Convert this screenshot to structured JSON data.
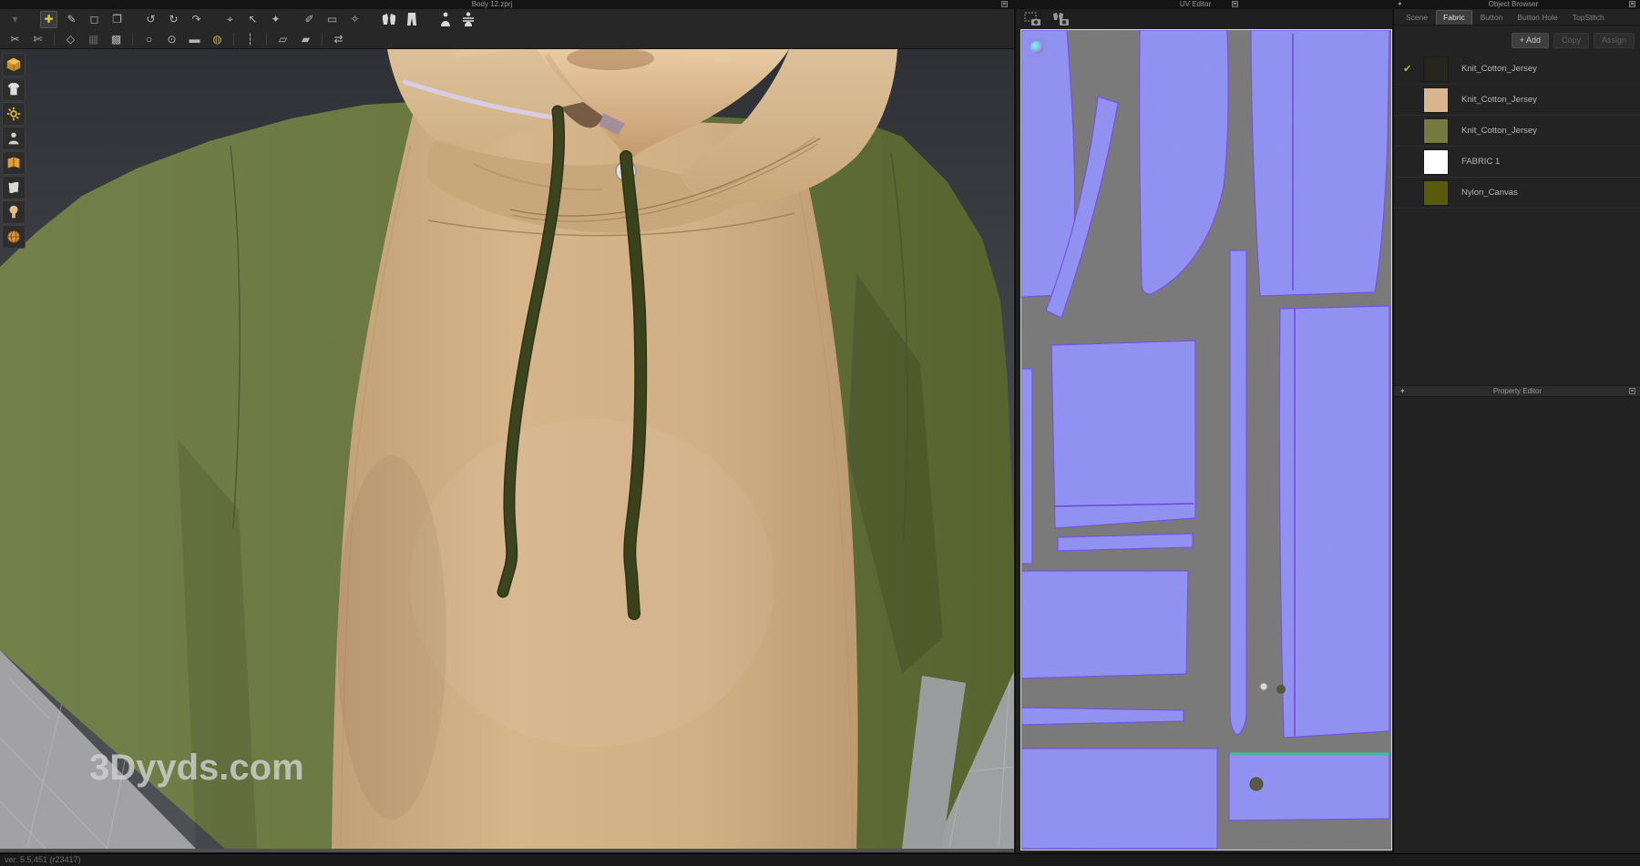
{
  "window": {
    "viewport_title": "Body 12.zprj",
    "uv_editor_title": "UV Editor",
    "object_browser_title": "Object Browser",
    "property_editor_title": "Property Editor"
  },
  "watermark": "3Dyyds.com",
  "status_bar": {
    "version_text": "ver. 5.5.451 (r23417)"
  },
  "toolbar": {
    "row1": [
      {
        "name": "import-dropdown-icon",
        "glyph": "▾",
        "variant": "dim"
      },
      {
        "name": "move-tool-icon",
        "glyph": "✚",
        "variant": "sel"
      },
      {
        "name": "edit-pattern-tool-icon",
        "glyph": "✎",
        "variant": ""
      },
      {
        "name": "transform-pattern-tool-icon",
        "glyph": "◻",
        "variant": ""
      },
      {
        "name": "paste-pattern-tool-icon",
        "glyph": "❐",
        "variant": ""
      },
      {
        "name": "fold-left-tool-icon",
        "glyph": "↺",
        "variant": ""
      },
      {
        "name": "fold-right-tool-icon",
        "glyph": "↻",
        "variant": ""
      },
      {
        "name": "fold-arrangement-tool-icon",
        "glyph": "↷",
        "variant": ""
      },
      {
        "name": "pin-tool-icon",
        "glyph": "⌖",
        "variant": ""
      },
      {
        "name": "drag-garment-tool-icon",
        "glyph": "↖",
        "variant": ""
      },
      {
        "name": "reset-garment-tool-icon",
        "glyph": "✦",
        "variant": ""
      },
      {
        "name": "sewing-edit-tool-icon",
        "glyph": "✐",
        "variant": ""
      },
      {
        "name": "steam-roller-tool-icon",
        "glyph": "▭",
        "variant": ""
      },
      {
        "name": "refresh-drape-tool-icon",
        "glyph": "✧",
        "variant": ""
      }
    ],
    "row2": [
      {
        "name": "trace-cursor-tool-icon",
        "glyph": "✂",
        "variant": ""
      },
      {
        "name": "cut-and-sew-tool-icon",
        "glyph": "✄",
        "variant": ""
      },
      {
        "name": "polygon-pattern-tool-icon",
        "glyph": "◇",
        "variant": ""
      },
      {
        "name": "mesh-select-tool-icon",
        "glyph": "▦",
        "variant": "dim"
      },
      {
        "name": "mesh-edit-tool-icon",
        "glyph": "▩",
        "variant": ""
      },
      {
        "name": "button-cursor-tool-icon",
        "glyph": "○",
        "variant": ""
      },
      {
        "name": "button-tool-icon",
        "glyph": "⊙",
        "variant": ""
      },
      {
        "name": "seam-line-tool-icon",
        "glyph": "▬",
        "variant": ""
      },
      {
        "name": "grading-lock-tool-icon",
        "glyph": "◍",
        "variant": "accent"
      },
      {
        "name": "zipper-tool-icon",
        "glyph": "┆",
        "variant": ""
      },
      {
        "name": "flattening-cursor-tool-icon",
        "glyph": "▱",
        "variant": ""
      },
      {
        "name": "flattening-tool-icon",
        "glyph": "▰",
        "variant": ""
      },
      {
        "name": "symmetry-tool-icon",
        "glyph": "⇄",
        "variant": ""
      }
    ]
  },
  "object_browser": {
    "tabs": [
      "Scene",
      "Fabric",
      "Button",
      "Button Hole",
      "TopStitch"
    ],
    "active_tab": "Fabric",
    "buttons": {
      "add": "+ Add",
      "copy": "Copy",
      "assign": "Assign"
    },
    "fabrics": [
      {
        "name": "Knit_Cotton_Jersey",
        "swatch": "#26261e",
        "selected": true
      },
      {
        "name": "Knit_Cotton_Jersey",
        "swatch": "#d9b48e",
        "selected": false
      },
      {
        "name": "Knit_Cotton_Jersey",
        "swatch": "#75793f",
        "selected": false
      },
      {
        "name": "FABRIC 1",
        "swatch": "#ffffff",
        "selected": false
      },
      {
        "name": "Nylon_Canvas",
        "swatch": "#5a5910",
        "selected": false
      }
    ]
  },
  "icons": {
    "check": "✔",
    "panel_arrow": "✦"
  },
  "colors": {
    "uv_piece_fill": "#8d8ef1",
    "uv_background": "#767676",
    "uv_outline": "#7150d8",
    "uv_teal_seam": "#3fb89f",
    "hoodie_tan": "#cfae81",
    "hoodie_green": "#68753e",
    "drawstring": "#3c441e",
    "active_check": "#d4b43c"
  }
}
